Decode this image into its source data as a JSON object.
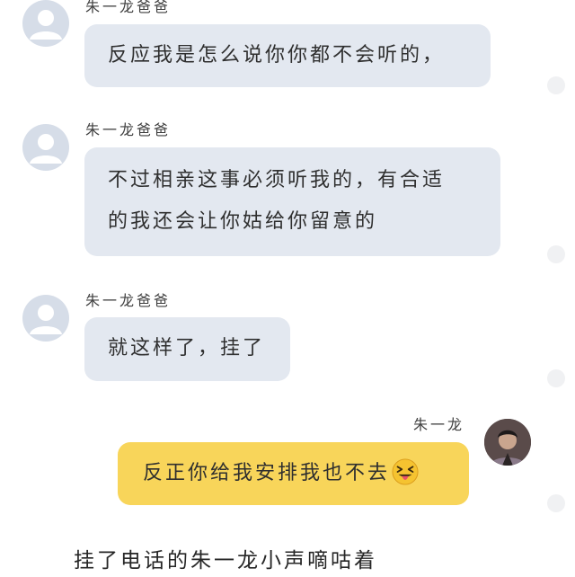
{
  "messages": [
    {
      "sender": "朱一龙爸爸",
      "text": "反应我是怎么说你你都不会听的，"
    },
    {
      "sender": "朱一龙爸爸",
      "lines": [
        "不过相亲这事必须听我的，有合适",
        "的我还会让你姑给你留意的"
      ]
    },
    {
      "sender": "朱一龙爸爸",
      "text": "就这样了，挂了"
    },
    {
      "sender": "朱一龙",
      "text": "反正你给我安排我也不去",
      "emoji": "squinting-face-with-tongue"
    }
  ],
  "narration": "挂了电话的朱一龙小声嘀咕着",
  "colors": {
    "received_bubble": "#e3e8f0",
    "sent_bubble": "#f8d55a",
    "background": "#ffffff"
  }
}
